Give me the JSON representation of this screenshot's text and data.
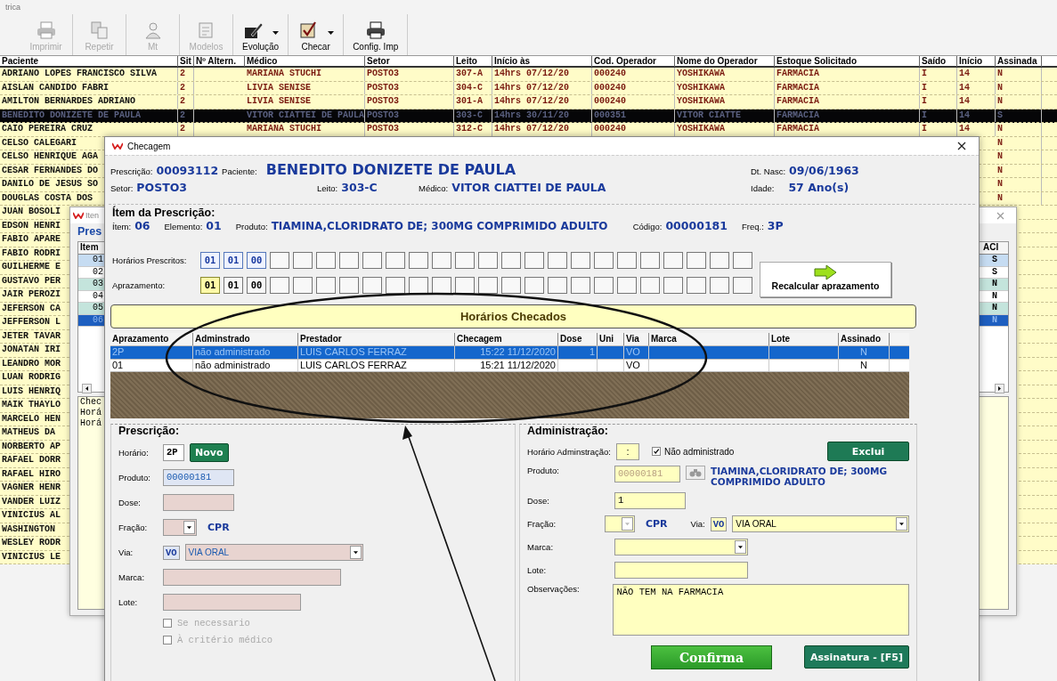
{
  "app": {
    "title": "trica"
  },
  "toolbar": [
    {
      "label": "Imprimir",
      "disabled": true,
      "dropdown": false
    },
    {
      "label": "Repetir",
      "disabled": true,
      "dropdown": false
    },
    {
      "label": "Mt",
      "disabled": true,
      "dropdown": false
    },
    {
      "label": "Modelos",
      "disabled": true,
      "dropdown": false
    },
    {
      "label": "Evolução",
      "disabled": false,
      "dropdown": true
    },
    {
      "label": "Checar",
      "disabled": false,
      "dropdown": true
    },
    {
      "label": "Config. Imp",
      "disabled": false,
      "dropdown": false
    }
  ],
  "patients_table": {
    "columns": [
      "Paciente",
      "Sit",
      "Nº Altern.",
      "Médico",
      "Setor",
      "Leito",
      "Início às",
      "Cod. Operador",
      "Nome do Operador",
      "Estoque Solicitado",
      "Saído",
      "Início",
      "Assinada"
    ],
    "rows": [
      {
        "selected": false,
        "cells": [
          "ADRIANO LOPES FRANCISCO SILVA",
          "2",
          null,
          "MARIANA STUCHI",
          "POSTO3",
          "307-A",
          "14hrs 07/12/20",
          "000240",
          "YOSHIKAWA",
          "FARMACIA",
          "I",
          "14",
          "N"
        ]
      },
      {
        "selected": false,
        "cells": [
          "AISLAN CANDIDO FABRI",
          "2",
          null,
          "LIVIA SENISE",
          "POSTO3",
          "304-C",
          "14hrs 07/12/20",
          "000240",
          "YOSHIKAWA",
          "FARMACIA",
          "I",
          "14",
          "N"
        ]
      },
      {
        "selected": false,
        "cells": [
          "AMILTON BERNARDES ADRIANO",
          "2",
          null,
          "LIVIA SENISE",
          "POSTO3",
          "301-A",
          "14hrs 07/12/20",
          "000240",
          "YOSHIKAWA",
          "FARMACIA",
          "I",
          "14",
          "N"
        ]
      },
      {
        "selected": true,
        "cells": [
          "BENEDITO DONIZETE DE PAULA",
          "2",
          null,
          "VITOR CIATTEI DE PAULA",
          "POSTO3",
          "303-C",
          "14hrs 30/11/20",
          "000351",
          "VITOR CIATTE",
          "FARMACIA",
          "I",
          "14",
          "S"
        ]
      },
      {
        "selected": false,
        "cells": [
          "CAIO PEREIRA CRUZ",
          "2",
          null,
          "MARIANA STUCHI",
          "POSTO3",
          "312-C",
          "14hrs 07/12/20",
          "000240",
          "YOSHIKAWA",
          "FARMACIA",
          "I",
          "14",
          "N"
        ]
      },
      {
        "selected": false,
        "cells": [
          "CELSO CALEGARI"
        ],
        "assinada": "N"
      },
      {
        "selected": false,
        "cells": [
          "CELSO HENRIQUE AGA"
        ],
        "assinada": "N"
      },
      {
        "selected": false,
        "cells": [
          "CESAR FERNANDES DO"
        ],
        "assinada": "N"
      },
      {
        "selected": false,
        "cells": [
          "DANILO DE JESUS SO"
        ],
        "assinada": "N"
      },
      {
        "selected": false,
        "cells": [
          "DOUGLAS COSTA DOS"
        ],
        "assinada": "N"
      },
      {
        "selected": false,
        "cells": [
          "JUAN BOSOLI"
        ]
      },
      {
        "selected": false,
        "cells": [
          "EDSON HENRI"
        ]
      },
      {
        "selected": false,
        "cells": [
          "FABIO APARE"
        ]
      },
      {
        "selected": false,
        "cells": [
          "FABIO RODRI"
        ]
      },
      {
        "selected": false,
        "cells": [
          "GUILHERME E"
        ]
      },
      {
        "selected": false,
        "cells": [
          "GUSTAVO PER"
        ]
      },
      {
        "selected": false,
        "cells": [
          "JAIR PEROZI"
        ]
      },
      {
        "selected": false,
        "cells": [
          "JEFERSON CA"
        ]
      },
      {
        "selected": false,
        "cells": [
          "JEFFERSON L"
        ]
      },
      {
        "selected": false,
        "cells": [
          "JETER TAVAR"
        ]
      },
      {
        "selected": false,
        "cells": [
          "JONATAN IRI"
        ]
      },
      {
        "selected": false,
        "cells": [
          "LEANDRO MOR"
        ]
      },
      {
        "selected": false,
        "cells": [
          "LUAN RODRIG"
        ]
      },
      {
        "selected": false,
        "cells": [
          "LUIS HENRIQ"
        ]
      },
      {
        "selected": false,
        "cells": [
          "MAIK THAYLO"
        ]
      },
      {
        "selected": false,
        "cells": [
          "MARCELO HEN"
        ]
      },
      {
        "selected": false,
        "cells": [
          "MATHEUS DA"
        ]
      },
      {
        "selected": false,
        "cells": [
          "NORBERTO AP"
        ]
      },
      {
        "selected": false,
        "cells": [
          "RAFAEL DORR"
        ]
      },
      {
        "selected": false,
        "cells": [
          "RAFAEL HIRO"
        ]
      },
      {
        "selected": false,
        "cells": [
          "VAGNER HENR"
        ]
      },
      {
        "selected": false,
        "cells": [
          "VANDER LUIZ"
        ]
      },
      {
        "selected": false,
        "cells": [
          "VINICIUS AL"
        ]
      },
      {
        "selected": false,
        "cells": [
          "WASHINGTON"
        ]
      },
      {
        "selected": false,
        "cells": [
          "WESLEY RODR"
        ]
      },
      {
        "selected": false,
        "cells": [
          "VINICIUS LE"
        ]
      }
    ]
  },
  "items_window": {
    "title": "Iten",
    "heading": "Pres",
    "columns": [
      "Item",
      "ACI"
    ],
    "items": [
      {
        "label": "01",
        "column_2": "S",
        "color": "#c6dcf2",
        "selected": false
      },
      {
        "label": "02",
        "column_2": "S",
        "color": "#ffffff",
        "selected": false
      },
      {
        "label": "03",
        "column_2": "N",
        "color": "#c4e4dc",
        "selected": false
      },
      {
        "label": "04",
        "column_2": "N",
        "color": "#ffffff",
        "selected": false
      },
      {
        "label": "05",
        "column_2": "N",
        "color": "#c4e4dc",
        "selected": false
      },
      {
        "label": "06",
        "column_2": "N",
        "selected": true
      }
    ],
    "notes": [
      "Chec",
      "Horá",
      "Horá"
    ]
  },
  "dialog": {
    "title": "Checagem",
    "header": {
      "prescricao_label": "Prescrição:",
      "prescricao": "00093112",
      "paciente_label": "Paciente:",
      "paciente": "BENEDITO DONIZETE DE PAULA",
      "nasc_label": "Dt. Nasc:",
      "nasc": "09/06/1963",
      "setor_label": "Setor:",
      "setor": "POSTO3",
      "leito_label": "Leito:",
      "leito": "303-C",
      "medico_label": "Médico:",
      "medico": "VITOR CIATTEI DE PAULA",
      "idade_label": "Idade:",
      "idade": "57 Ano(s)"
    },
    "item": {
      "legend": "Ítem da Prescrição:",
      "item_label": "Ítem:",
      "item": "06",
      "elemento_label": "Elemento:",
      "elemento": "01",
      "produto_label": "Produto:",
      "produto": "TIAMINA,CLORIDRATO DE; 300MG COMPRIMIDO ADULTO",
      "codigo_label": "Código:",
      "codigo": "00000181",
      "freq_label": "Freq.:",
      "freq": "3P",
      "prescritos_label": "Horários Prescritos:",
      "prescritos": [
        "01",
        "01",
        "00"
      ],
      "aprazamento_label": "Aprazamento:",
      "aprazamento": [
        {
          "value": "01",
          "selected": true
        },
        {
          "value": "01",
          "selected": false
        },
        {
          "value": "00",
          "selected": false
        }
      ],
      "recalcular": "Recalcular aprazamento"
    },
    "checados_title": "Horários Checados",
    "checados": {
      "columns": [
        "Aprazamento",
        "Adminstrado",
        "Prestador",
        "Checagem",
        "Dose",
        "Uni",
        "Via",
        "Marca",
        "Lote",
        "Assinado"
      ],
      "rows": [
        {
          "selected": true,
          "aprazamento": "2P",
          "administrado": "não administrado",
          "prestador": "LUIS CARLOS FERRAZ",
          "checagem": "15:22   11/12/2020",
          "dose": "1",
          "via": "VO",
          "assinado": "N"
        },
        {
          "selected": false,
          "aprazamento": "01",
          "administrado": "não administrado",
          "prestador": "LUIS CARLOS FERRAZ",
          "checagem": "15:21   11/12/2020",
          "via": "VO",
          "assinado": "N"
        }
      ]
    },
    "prescricao": {
      "legend": "Prescrição:",
      "horario_label": "Horário:",
      "horario": "2P",
      "novo": "Novo",
      "produto_label": "Produto:",
      "produto": "00000181",
      "dose_label": "Dose:",
      "fracao_label": "Fração:",
      "unidade": "CPR",
      "via_label": "Via:",
      "via_code": "VO",
      "via": "VIA ORAL",
      "marca_label": "Marca:",
      "lote_label": "Lote:",
      "checks": [
        {
          "label": "Se necessario",
          "checked": false,
          "disabled": true
        },
        {
          "label": "À critério médico",
          "checked": false,
          "disabled": true
        }
      ]
    },
    "administracao": {
      "legend": "Administração:",
      "horario_label": "Horário Adminstração:",
      "horario": ":",
      "nao_administrado": {
        "label": "Não administrado",
        "checked": true
      },
      "exclui": "Exclui",
      "produto_label": "Produto:",
      "produto_codigo": "00000181",
      "produto": "TIAMINA,CLORIDRATO DE; 300MG COMPRIMIDO ADULTO",
      "dose_label": "Dose:",
      "dose": "1",
      "fracao_label": "Fração:",
      "unidade": "CPR",
      "via_label": "Via:",
      "via_code": "VO",
      "via": "VIA ORAL",
      "marca_label": "Marca:",
      "lote_label": "Lote:",
      "obs_label": "Observações:",
      "obs": "NÃO TEM NA FARMACIA",
      "confirma": "Confirma",
      "assinatura": "Assinatura - [F5]"
    }
  }
}
